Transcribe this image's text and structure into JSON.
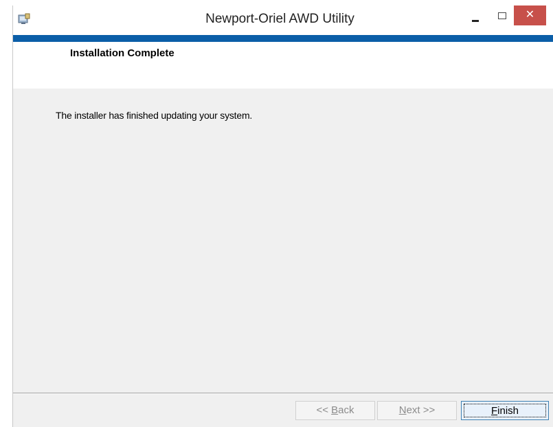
{
  "window": {
    "title": "Newport-Oriel AWD Utility",
    "close_glyph": "✕",
    "app_icon": "installer-icon"
  },
  "banner": {
    "title": "Installation Complete"
  },
  "main": {
    "message": "The installer has finished updating your system."
  },
  "buttons": {
    "back": {
      "prefix": "<< ",
      "mnemonic": "B",
      "rest": "ack"
    },
    "next": {
      "mnemonic": "N",
      "rest": "ext >>"
    },
    "finish": {
      "mnemonic": "F",
      "rest": "inish"
    }
  },
  "colors": {
    "accent": "#0b5ea8",
    "close": "#c7504a"
  }
}
